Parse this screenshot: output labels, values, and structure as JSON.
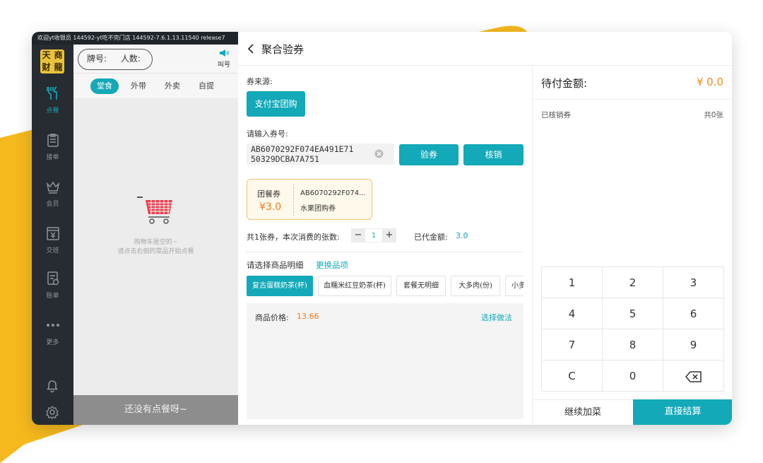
{
  "status_bar": {
    "text": "欢迎yt收银员  144592-yt吃不完门店  144592-7.6.1.13.11540  release7"
  },
  "sidebar": {
    "logo": [
      "天",
      "商",
      "财",
      "龍"
    ],
    "items": [
      {
        "label": "点餐",
        "icon": "cutlery-icon",
        "active": true
      },
      {
        "label": "接单",
        "icon": "clipboard-icon"
      },
      {
        "label": "会员",
        "icon": "crown-icon"
      },
      {
        "label": "交班",
        "icon": "cashbox-icon"
      },
      {
        "label": "账单",
        "icon": "bill-icon"
      },
      {
        "label": "更多",
        "icon": "more-dots-icon"
      }
    ],
    "bottom_icons": [
      "bell-icon",
      "settings-icon"
    ]
  },
  "order": {
    "table_label": "牌号:",
    "people_label": "人数:",
    "call_label": "叫号",
    "modes": [
      "堂食",
      "外带",
      "外卖",
      "自提"
    ],
    "active_mode": "堂食",
    "empty_line1": "购物车是空的~",
    "empty_line2": "请点击右侧的菜品开始点餐",
    "no_order_text": "还没有点餐呀~"
  },
  "dialog": {
    "title": "聚合验券",
    "source_label": "券来源:",
    "source_button": "支付宝团购",
    "input_label": "请输入券号:",
    "coupon_line1": "AB6070292F074EA491E71",
    "coupon_line2": "50329DCBA7A751",
    "verify_button": "验券",
    "redeem_button": "核销",
    "ticket": {
      "type": "团餐券",
      "price": "¥3.0",
      "code": "AB6070292F074...",
      "name": "水果团购券"
    },
    "summary_text": "共1张券，本次消费的张数:",
    "quantity": "1",
    "minus": "−",
    "plus": "+",
    "paid_label": "已代金额:",
    "paid_value": "3.0",
    "select_label": "请选择商品明细",
    "change_link": "更换品项",
    "chips": [
      "复古蛋糕奶茶(杯)",
      "血糯米红豆奶茶(杯)",
      "套餐无明细",
      "大多肉(份)",
      "小多"
    ],
    "active_chip": "复古蛋糕奶茶(杯)",
    "price_label": "商品价格:",
    "price_value": "13.66",
    "choose_method": "选择做法"
  },
  "payment": {
    "due_label": "待付金额:",
    "due_value": "¥ 0.0",
    "verified_label": "已核销券",
    "verified_count": "共0张",
    "keys": [
      "1",
      "2",
      "3",
      "4",
      "5",
      "6",
      "7",
      "8",
      "9",
      "C",
      "0",
      "backspace"
    ],
    "continue_button": "继续加菜",
    "checkout_button": "直接结算"
  },
  "colors": {
    "accent": "#13a9b8",
    "orange": "#f0891a",
    "deco_yellow": "#f5b91e"
  }
}
